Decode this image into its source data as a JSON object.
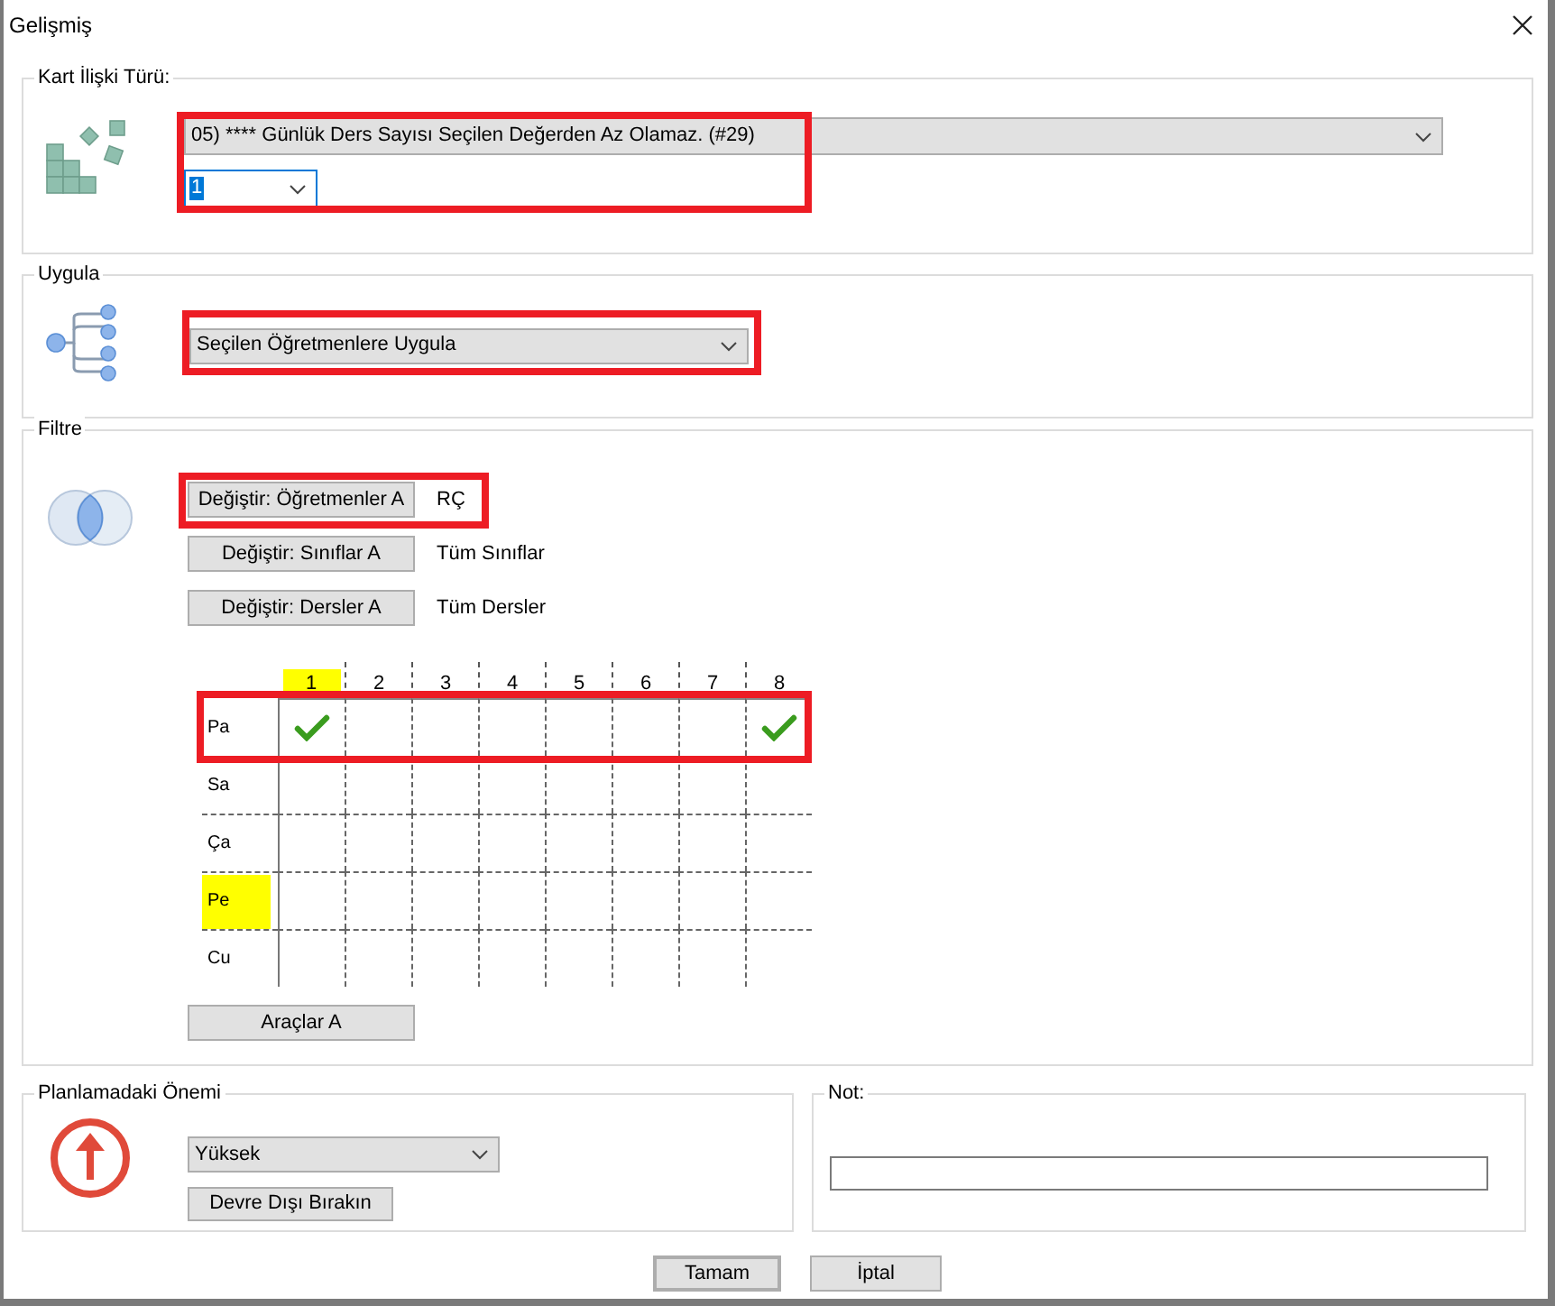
{
  "window": {
    "title": "Gelişmiş"
  },
  "relation": {
    "label": "Kart İlişki Türü:",
    "rule": "05) **** Günlük Ders Sayısı Seçilen Değerden Az Olamaz. (#29)",
    "value": "1"
  },
  "apply": {
    "label": "Uygula",
    "value": "Seçilen Öğretmenlere Uygula"
  },
  "filter": {
    "label": "Filtre",
    "changes": [
      {
        "button": "Değiştir: Öğretmenler A",
        "value": "RÇ"
      },
      {
        "button": "Değiştir: Sınıflar A",
        "value": "Tüm Sınıflar"
      },
      {
        "button": "Değiştir: Dersler A",
        "value": "Tüm Dersler"
      }
    ],
    "grid": {
      "columns": [
        {
          "label": "1",
          "highlighted": true
        },
        {
          "label": "2",
          "highlighted": false
        },
        {
          "label": "3",
          "highlighted": false
        },
        {
          "label": "4",
          "highlighted": false
        },
        {
          "label": "5",
          "highlighted": false
        },
        {
          "label": "6",
          "highlighted": false
        },
        {
          "label": "7",
          "highlighted": false
        },
        {
          "label": "8",
          "highlighted": false
        }
      ],
      "rows": [
        {
          "label": "Pa",
          "highlighted": false,
          "cells": [
            {
              "checked": true
            },
            {
              "checked": false
            },
            {
              "checked": false
            },
            {
              "checked": false
            },
            {
              "checked": false
            },
            {
              "checked": false
            },
            {
              "checked": false
            },
            {
              "checked": true
            }
          ]
        },
        {
          "label": "Sa",
          "highlighted": false,
          "cells": [
            {
              "checked": false
            },
            {
              "checked": false
            },
            {
              "checked": false
            },
            {
              "checked": false
            },
            {
              "checked": false
            },
            {
              "checked": false
            },
            {
              "checked": false
            },
            {
              "checked": false
            }
          ]
        },
        {
          "label": "Ça",
          "highlighted": false,
          "cells": [
            {
              "checked": false
            },
            {
              "checked": false
            },
            {
              "checked": false
            },
            {
              "checked": false
            },
            {
              "checked": false
            },
            {
              "checked": false
            },
            {
              "checked": false
            },
            {
              "checked": false
            }
          ]
        },
        {
          "label": "Pe",
          "highlighted": true,
          "cells": [
            {
              "checked": false
            },
            {
              "checked": false
            },
            {
              "checked": false
            },
            {
              "checked": false
            },
            {
              "checked": false
            },
            {
              "checked": false
            },
            {
              "checked": false
            },
            {
              "checked": false
            }
          ]
        },
        {
          "label": "Cu",
          "highlighted": false,
          "cells": [
            {
              "checked": false
            },
            {
              "checked": false
            },
            {
              "checked": false
            },
            {
              "checked": false
            },
            {
              "checked": false
            },
            {
              "checked": false
            },
            {
              "checked": false
            },
            {
              "checked": false
            }
          ]
        }
      ]
    },
    "tools": "Araçlar A"
  },
  "importance": {
    "label": "Planlamadaki Önemi",
    "value": "Yüksek",
    "button": "Devre Dışı Bırakın"
  },
  "note": {
    "label": "Not:"
  },
  "buttons": [
    {
      "label": "Tamam",
      "default": true
    },
    {
      "label": "İptal",
      "default": false
    }
  ]
}
